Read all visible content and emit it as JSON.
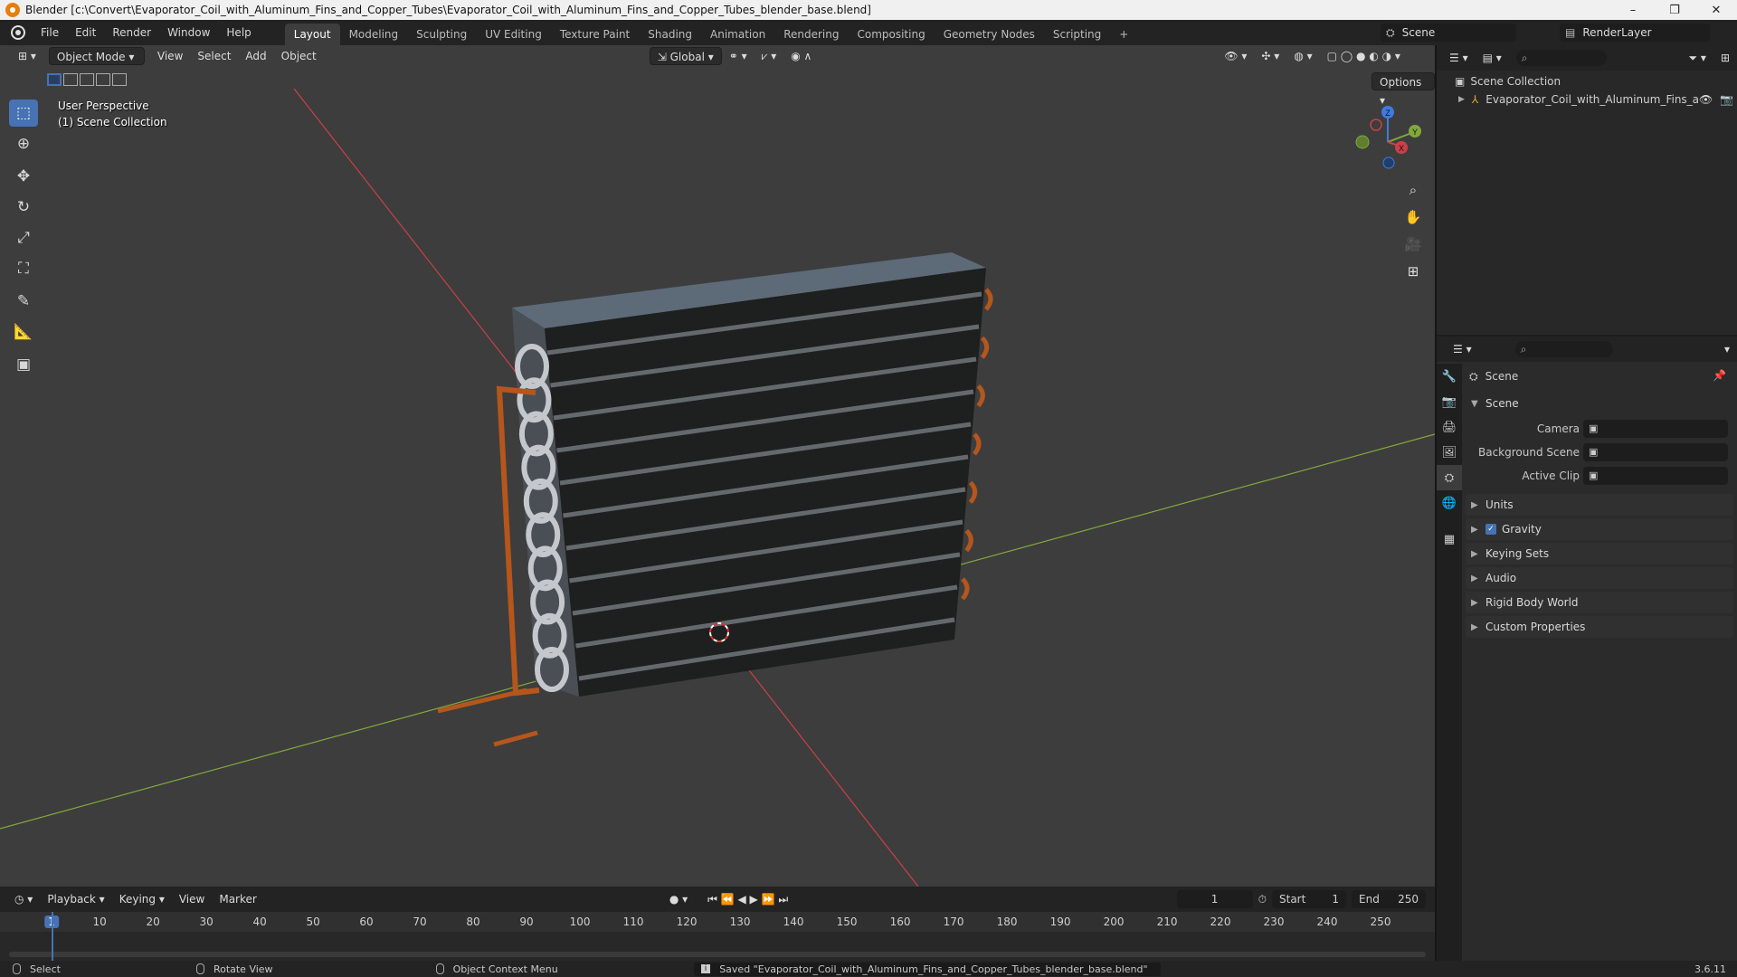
{
  "window": {
    "title": "Blender [c:\\Convert\\Evaporator_Coil_with_Aluminum_Fins_and_Copper_Tubes\\Evaporator_Coil_with_Aluminum_Fins_and_Copper_Tubes_blender_base.blend]",
    "minimize": "–",
    "maximize": "❐",
    "close": "✕"
  },
  "menu": [
    "File",
    "Edit",
    "Render",
    "Window",
    "Help"
  ],
  "workspaces": [
    "Layout",
    "Modeling",
    "Sculpting",
    "UV Editing",
    "Texture Paint",
    "Shading",
    "Animation",
    "Rendering",
    "Compositing",
    "Geometry Nodes",
    "Scripting",
    "+"
  ],
  "active_workspace": "Layout",
  "scene_selector": {
    "scene": "Scene",
    "render_layer": "RenderLayer"
  },
  "viewport": {
    "mode": "Object Mode",
    "menus": [
      "View",
      "Select",
      "Add",
      "Object"
    ],
    "transform_orientation": "Global",
    "options_label": "Options",
    "perspective_label": "User Perspective",
    "collection_label": "(1) Scene Collection",
    "gizmo": {
      "x": "X",
      "y": "Y",
      "z": "Z"
    }
  },
  "outliner": {
    "root": "Scene Collection",
    "items": [
      {
        "label": "Evaporator_Coil_with_Aluminum_Fins_a"
      }
    ]
  },
  "properties": {
    "header": "Scene",
    "section": "Scene",
    "fields": [
      {
        "label": "Camera"
      },
      {
        "label": "Background Scene"
      },
      {
        "label": "Active Clip"
      }
    ],
    "panels": [
      "Units",
      "Gravity",
      "Keying Sets",
      "Audio",
      "Rigid Body World",
      "Custom Properties"
    ],
    "gravity_checked": true
  },
  "timeline": {
    "menus": [
      "Playback",
      "Keying",
      "View",
      "Marker"
    ],
    "current_frame": "1",
    "start_label": "Start",
    "start": "1",
    "end_label": "End",
    "end": "250",
    "ticks": [
      "1",
      "10",
      "20",
      "30",
      "40",
      "50",
      "60",
      "70",
      "80",
      "90",
      "100",
      "110",
      "120",
      "130",
      "140",
      "150",
      "160",
      "170",
      "180",
      "190",
      "200",
      "210",
      "220",
      "230",
      "240",
      "250"
    ]
  },
  "statusbar": {
    "select": "Select",
    "rotate": "Rotate View",
    "context": "Object Context Menu",
    "message": "Saved \"Evaporator_Coil_with_Aluminum_Fins_and_Copper_Tubes_blender_base.blend\"",
    "version": "3.6.11"
  },
  "colors": {
    "accent": "#4772b3",
    "x_axis": "#c94049",
    "y_axis": "#82a83a",
    "z_axis": "#3f7be0",
    "copper": "#b5561c"
  }
}
